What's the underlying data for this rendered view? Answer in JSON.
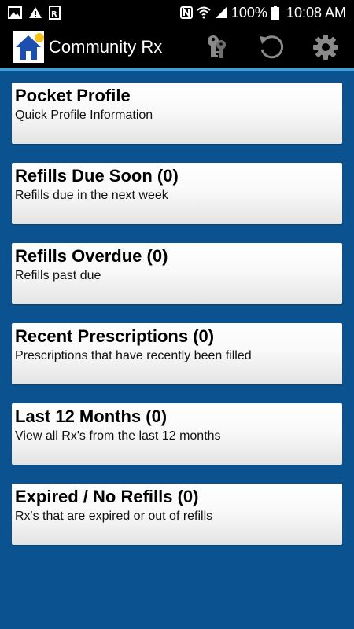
{
  "status_bar": {
    "battery_percent": "100%",
    "time": "10:08 AM",
    "left_icons": [
      "image-icon",
      "warning-icon",
      "rx-notification-icon"
    ],
    "right_icons": [
      "nfc-icon",
      "wifi-icon",
      "cell-signal-icon",
      "battery-icon"
    ]
  },
  "app_bar": {
    "title": "Community Rx",
    "logo_icon": "house-logo-icon",
    "actions": [
      "keys-icon",
      "refresh-icon",
      "gear-icon"
    ]
  },
  "colors": {
    "background": "#0a5390",
    "app_bar": "#000000",
    "accent_line": "#3aa0dc",
    "logo_blue": "#1d4fb0",
    "logo_sun": "#f4c21c"
  },
  "menu": {
    "items": [
      {
        "title": "Pocket Profile",
        "subtitle": "Quick Profile Information"
      },
      {
        "title": "Refills Due Soon (0)",
        "subtitle": "Refills due in the next week"
      },
      {
        "title": "Refills Overdue (0)",
        "subtitle": "Refills past due"
      },
      {
        "title": "Recent Prescriptions (0)",
        "subtitle": "Prescriptions that have recently been filled"
      },
      {
        "title": "Last 12 Months (0)",
        "subtitle": "View all Rx's from the last 12 months"
      },
      {
        "title": "Expired / No Refills (0)",
        "subtitle": "Rx's that are expired or out of refills"
      }
    ]
  }
}
